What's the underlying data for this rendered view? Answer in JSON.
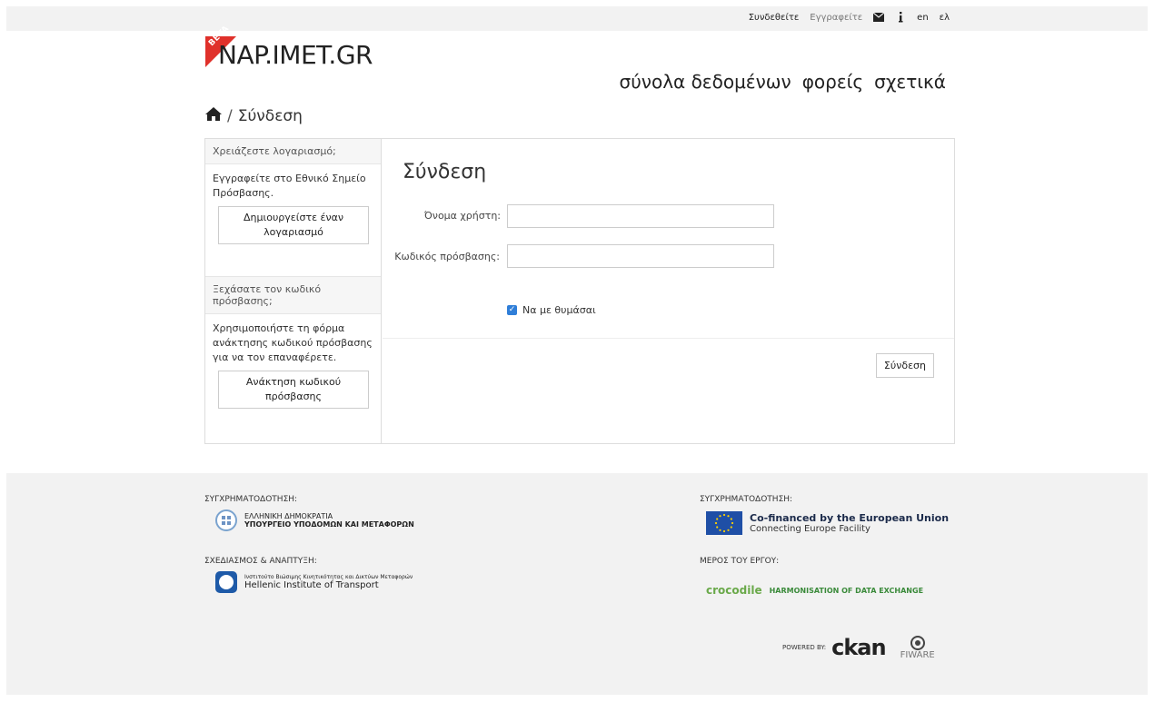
{
  "topbar": {
    "login": "Συνδεθείτε",
    "register": "Εγγραφείτε",
    "lang_en": "en",
    "lang_el": "ελ",
    "icons": [
      "envelope-icon",
      "info-icon"
    ]
  },
  "logo": {
    "badge": "BETA",
    "text": "NAP.IMET.GR"
  },
  "nav": {
    "items": [
      "σύνολα δεδομένων",
      "φορείς",
      "σχετικά"
    ]
  },
  "breadcrumb": {
    "home_icon": "home-icon",
    "current": "Σύνδεση"
  },
  "sidebar": {
    "account_head": "Χρειάζεστε λογαριασμό;",
    "account_body": "Εγγραφείτε στο Εθνικό Σημείο Πρόσβασης.",
    "account_button": "Δημιουργείστε έναν λογαριασμό",
    "forgot_head": "Ξεχάσατε τον κωδικό πρόσβασης;",
    "forgot_body": "Χρησιμοποιήστε τη φόρμα ανάκτησης κωδικού πρόσβασης για να τον επαναφέρετε.",
    "forgot_button": "Ανάκτηση κωδικού πρόσβασης"
  },
  "form": {
    "title": "Σύνδεση",
    "username_label": "Όνομα χρήστη:",
    "username_value": "",
    "password_label": "Κωδικός πρόσβασης:",
    "password_value": "",
    "remember_label": "Να με θυμάσαι",
    "remember_checked": true,
    "submit_label": "Σύνδεση"
  },
  "footer": {
    "cofund_label_left": "ΣΥΓΧΡΗΜΑΤΟΔΟΤΗΣΗ:",
    "ministry_line1": "ΕΛΛΗΝΙΚΗ ΔΗΜΟΚΡΑΤΙΑ",
    "ministry_line2": "ΥΠΟΥΡΓΕΙΟ ΥΠΟΔΟΜΩΝ ΚΑΙ ΜΕΤΑΦΟΡΩΝ",
    "design_label": "ΣΧΕΔΙΑΣΜΟΣ & ΑΝΑΠΤΥΞΗ:",
    "hit_line1": "Ινστιτούτο Βιώσιμης Κινητικότητας και Δικτύων Μεταφορών",
    "hit_line2": "Hellenic Institute of Transport",
    "cofund_label_right": "ΣΥΓΧΡΗΜΑΤΟΔΟΤΗΣΗ:",
    "eu_line1": "Co-financed by the European Union",
    "eu_line2": "Connecting Europe Facility",
    "part_label": "ΜΕΡΟΣ ΤΟΥ ΕΡΓΟΥ:",
    "croc_name": "crocodile",
    "croc_sub": "HARMONISATION OF DATA EXCHANGE",
    "powered_by": "POWERED BY:",
    "ckan": "ckan",
    "fiware": "FIWARE"
  }
}
